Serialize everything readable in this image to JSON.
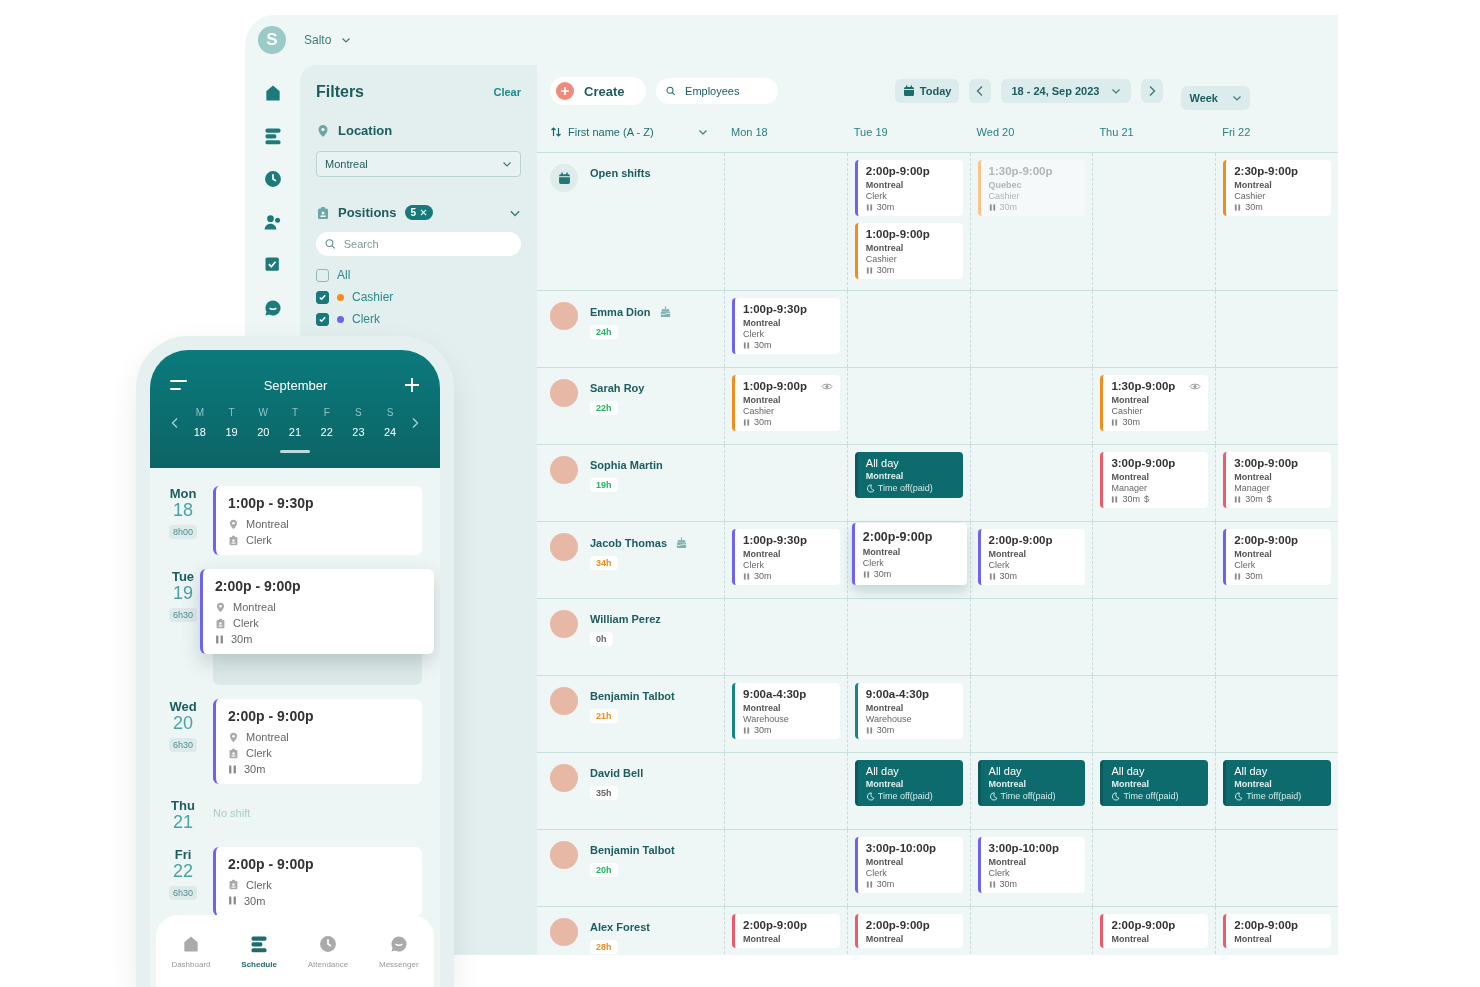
{
  "workspace": {
    "avatar_letter": "S",
    "name": "Salto"
  },
  "rail": [
    {
      "kind": "home"
    },
    {
      "kind": "schedule"
    },
    {
      "kind": "clock"
    },
    {
      "kind": "people"
    },
    {
      "kind": "checklist"
    },
    {
      "kind": "chat"
    }
  ],
  "filters": {
    "title": "Filters",
    "clear": "Clear",
    "location": {
      "label": "Location",
      "value": "Montreal"
    },
    "positions": {
      "label": "Positions",
      "count": "5",
      "expanded": true,
      "search_placeholder": "Search",
      "options": [
        {
          "label": "All",
          "checked": false
        },
        {
          "label": "Cashier",
          "checked": true,
          "color": "#f28c1b"
        },
        {
          "label": "Clerk",
          "checked": true,
          "color": "#6c63f0"
        }
      ]
    }
  },
  "toolbar": {
    "create": "Create",
    "search_placeholder": "Employees",
    "today": "Today",
    "range": "18 - 24, Sep 2023",
    "view": "Week"
  },
  "sort": "First name (A - Z)",
  "days": [
    "Mon 18",
    "Tue 19",
    "Wed 20",
    "Thu 21",
    "Fri 22"
  ],
  "open_shifts": {
    "label": "Open shifts",
    "cells": [
      {},
      {
        "shifts": [
          {
            "kind": "shift",
            "time": "2:00p-9:00p",
            "location": "Montreal",
            "role": "Clerk",
            "break": "30m",
            "color": "#6c63f0",
            "faded": false,
            "lifted": false,
            "seen": false
          },
          {
            "kind": "shift",
            "time": "1:00p-9:00p",
            "location": "Montreal",
            "role": "Cashier",
            "break": "30m",
            "color": "#f28c1b",
            "faded": false,
            "lifted": false,
            "seen": false
          }
        ]
      },
      {
        "shifts": [
          {
            "kind": "shift",
            "time": "1:30p-9:00p",
            "location": "Quebec",
            "role": "Cashier",
            "break": "30m",
            "color": "#f8c48c",
            "faded": true,
            "lifted": false,
            "seen": false
          }
        ]
      },
      {},
      {
        "shifts": [
          {
            "kind": "shift",
            "time": "2:30p-9:00p",
            "location": "Montreal",
            "role": "Cashier",
            "break": "30m",
            "color": "#f28c1b",
            "faded": false,
            "lifted": false,
            "seen": false
          }
        ]
      }
    ]
  },
  "employees": [
    {
      "name": "Emma Dion",
      "hours": "24h",
      "color": "#22b35e",
      "birthday": true,
      "cells": [
        {
          "shifts": [
            {
              "kind": "shift",
              "time": "1:00p-9:30p",
              "location": "Montreal",
              "role": "Clerk",
              "break": "30m",
              "color": "#6c63f0",
              "faded": false,
              "lifted": false,
              "seen": false
            }
          ]
        },
        {},
        {},
        {},
        {}
      ]
    },
    {
      "name": "Sarah Roy",
      "hours": "22h",
      "color": "#22b35e",
      "birthday": false,
      "cells": [
        {
          "shifts": [
            {
              "kind": "shift",
              "time": "1:00p-9:00p",
              "location": "Montreal",
              "role": "Cashier",
              "break": "30m",
              "color": "#f28c1b",
              "faded": false,
              "lifted": false,
              "seen": true
            }
          ]
        },
        {},
        {},
        {
          "shifts": [
            {
              "kind": "shift",
              "time": "1:30p-9:00p",
              "location": "Montreal",
              "role": "Cashier",
              "break": "30m",
              "color": "#f28c1b",
              "faded": false,
              "lifted": false,
              "seen": true
            }
          ]
        },
        {}
      ]
    },
    {
      "name": "Sophia Martin",
      "hours": "19h",
      "color": "#22b35e",
      "birthday": false,
      "cells": [
        {},
        {
          "shifts": [
            {
              "kind": "timeoff",
              "time": "All day",
              "location": "Montreal",
              "note": "Time off(paid)"
            }
          ]
        },
        {},
        {
          "shifts": [
            {
              "kind": "shift",
              "time": "3:00p-9:00p",
              "location": "Montreal",
              "role": "Manager",
              "break": "30m",
              "pay": "$",
              "color": "#ef5a6a",
              "faded": false,
              "lifted": false,
              "seen": false
            }
          ]
        },
        {
          "shifts": [
            {
              "kind": "shift",
              "time": "3:00p-9:00p",
              "location": "Montreal",
              "role": "Manager",
              "break": "30m",
              "pay": "$",
              "color": "#ef5a6a",
              "faded": false,
              "lifted": false,
              "seen": false
            }
          ]
        }
      ]
    },
    {
      "name": "Jacob Thomas",
      "hours": "34h",
      "color": "#f28c1b",
      "birthday": true,
      "cells": [
        {
          "shifts": [
            {
              "kind": "shift",
              "time": "1:00p-9:30p",
              "location": "Montreal",
              "role": "Clerk",
              "break": "30m",
              "color": "#6c63f0",
              "faded": false,
              "lifted": false,
              "seen": false
            }
          ]
        },
        {
          "shifts": [
            {
              "kind": "shift",
              "time": "2:00p-9:00p",
              "location": "Montreal",
              "role": "Clerk",
              "break": "30m",
              "color": "#6c63f0",
              "faded": false,
              "lifted": true,
              "seen": false
            }
          ]
        },
        {
          "shifts": [
            {
              "kind": "shift",
              "time": "2:00p-9:00p",
              "location": "Montreal",
              "role": "Clerk",
              "break": "30m",
              "color": "#6c63f0",
              "faded": false,
              "lifted": false,
              "seen": false
            }
          ]
        },
        {},
        {
          "shifts": [
            {
              "kind": "shift",
              "time": "2:00p-9:00p",
              "location": "Montreal",
              "role": "Clerk",
              "break": "30m",
              "color": "#6c63f0",
              "faded": false,
              "lifted": false,
              "seen": false
            }
          ]
        }
      ]
    },
    {
      "name": "William Perez",
      "hours": "0h",
      "color": "#666666",
      "birthday": false,
      "cells": [
        {},
        {},
        {},
        {},
        {}
      ]
    },
    {
      "name": "Benjamin Talbot",
      "hours": "21h",
      "color": "#f28c1b",
      "birthday": false,
      "cells": [
        {
          "shifts": [
            {
              "kind": "shift",
              "time": "9:00a-4:30p",
              "location": "Montreal",
              "role": "Warehouse",
              "break": "30m",
              "color": "#14868a",
              "faded": false,
              "lifted": false,
              "seen": false
            }
          ]
        },
        {
          "shifts": [
            {
              "kind": "shift",
              "time": "9:00a-4:30p",
              "location": "Montreal",
              "role": "Warehouse",
              "break": "30m",
              "color": "#14868a",
              "faded": false,
              "lifted": false,
              "seen": false
            }
          ]
        },
        {},
        {},
        {}
      ]
    },
    {
      "name": "David Bell",
      "hours": "35h",
      "color": "#666666",
      "birthday": false,
      "cells": [
        {},
        {
          "shifts": [
            {
              "kind": "timeoff",
              "time": "All day",
              "location": "Montreal",
              "note": "Time off(paid)"
            }
          ]
        },
        {
          "shifts": [
            {
              "kind": "timeoff",
              "time": "All day",
              "location": "Montreal",
              "note": "Time off(paid)"
            }
          ]
        },
        {
          "shifts": [
            {
              "kind": "timeoff",
              "time": "All day",
              "location": "Montreal",
              "note": "Time off(paid)"
            }
          ]
        },
        {
          "shifts": [
            {
              "kind": "timeoff",
              "time": "All day",
              "location": "Montreal",
              "note": "Time off(paid)"
            }
          ]
        }
      ]
    },
    {
      "name": "Benjamin Talbot",
      "hours": "20h",
      "color": "#22b35e",
      "birthday": false,
      "cells": [
        {},
        {
          "shifts": [
            {
              "kind": "shift",
              "time": "3:00p-10:00p",
              "location": "Montreal",
              "role": "Clerk",
              "break": "30m",
              "color": "#6c63f0",
              "faded": false,
              "lifted": false,
              "seen": false
            }
          ]
        },
        {
          "shifts": [
            {
              "kind": "shift",
              "time": "3:00p-10:00p",
              "location": "Montreal",
              "role": "Clerk",
              "break": "30m",
              "color": "#6c63f0",
              "faded": false,
              "lifted": false,
              "seen": false
            }
          ]
        },
        {},
        {}
      ]
    },
    {
      "name": "Alex Forest",
      "hours": "28h",
      "color": "#f28c1b",
      "birthday": false,
      "cells": [
        {
          "shifts": [
            {
              "kind": "shift",
              "time": "2:00p-9:00p",
              "location": "Montreal",
              "color": "#ef5a6a",
              "faded": false,
              "lifted": false,
              "seen": false
            }
          ]
        },
        {
          "shifts": [
            {
              "kind": "shift",
              "time": "2:00p-9:00p",
              "location": "Montreal",
              "color": "#ef5a6a",
              "faded": false,
              "lifted": false,
              "seen": false
            }
          ]
        },
        {},
        {
          "shifts": [
            {
              "kind": "shift",
              "time": "2:00p-9:00p",
              "location": "Montreal",
              "color": "#ef5a6a",
              "faded": false,
              "lifted": false,
              "seen": false
            }
          ]
        },
        {
          "shifts": [
            {
              "kind": "shift",
              "time": "2:00p-9:00p",
              "location": "Montreal",
              "color": "#ef5a6a",
              "faded": false,
              "lifted": false,
              "seen": false
            }
          ]
        }
      ]
    }
  ],
  "phone": {
    "month": "September",
    "weekdays": [
      "M",
      "T",
      "W",
      "T",
      "F",
      "S",
      "S"
    ],
    "dates": [
      "18",
      "19",
      "20",
      "21",
      "22",
      "23",
      "24"
    ],
    "days": [
      {
        "weekday": "Mon",
        "date": "18",
        "total": "8h00",
        "shifts": [
          {
            "time": "1:00p - 9:30p",
            "location": "Montreal",
            "role": "Clerk",
            "lifted": false
          }
        ]
      },
      {
        "weekday": "Tue",
        "date": "19",
        "total": "6h30",
        "shifts": [
          {
            "time": "2:00p - 9:00p",
            "location": "Montreal",
            "role": "Clerk",
            "break": "30m",
            "lifted": true
          }
        ]
      },
      {
        "weekday": "Wed",
        "date": "20",
        "total": "6h30",
        "shifts": [
          {
            "time": "2:00p - 9:00p",
            "location": "Montreal",
            "role": "Clerk",
            "break": "30m",
            "lifted": false
          }
        ]
      },
      {
        "weekday": "Thu",
        "date": "21",
        "empty": "No shift"
      },
      {
        "weekday": "Fri",
        "date": "22",
        "total": "6h30",
        "shifts": [
          {
            "time": "2:00p - 9:00p",
            "role": "Clerk",
            "break": "30m",
            "lifted": false
          }
        ]
      }
    ],
    "nav": [
      {
        "label": "Dashboard",
        "kind": "home",
        "selected": false
      },
      {
        "label": "Schedule",
        "kind": "schedule",
        "selected": true
      },
      {
        "label": "Attendance",
        "kind": "clock",
        "selected": false
      },
      {
        "label": "Messenger",
        "kind": "chat",
        "selected": false
      }
    ]
  }
}
